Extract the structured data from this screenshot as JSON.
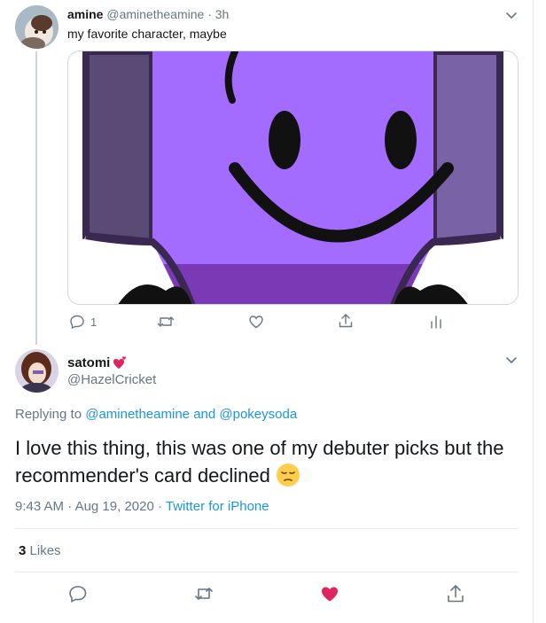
{
  "tweet1": {
    "name": "amine",
    "handle": "@aminetheamine",
    "time": "3h",
    "text": "my favorite character, maybe",
    "reply_count": "1"
  },
  "tweet2": {
    "name": "satomi",
    "handle": "@HazelCricket",
    "replying_label": "Replying to",
    "reply_user_1": "@aminetheamine",
    "reply_and": "and",
    "reply_user_2": "@pokeysoda",
    "text": "I love this thing, this was one of my debuter picks but the recommender's card declined",
    "time": "9:43 AM",
    "date": "Aug 19, 2020",
    "source": "Twitter for iPhone",
    "likes_count": "3",
    "likes_label": "Likes"
  },
  "colors": {
    "accent": "#1b95e0",
    "like_red": "#e0245e",
    "muted": "#657786",
    "purple": "#a36cff"
  },
  "icons": [
    "chevron-down-icon",
    "reply-icon",
    "retweet-icon",
    "like-icon",
    "share-icon",
    "analytics-icon",
    "heart-emoji-icon",
    "pensive-emoji-icon"
  ]
}
